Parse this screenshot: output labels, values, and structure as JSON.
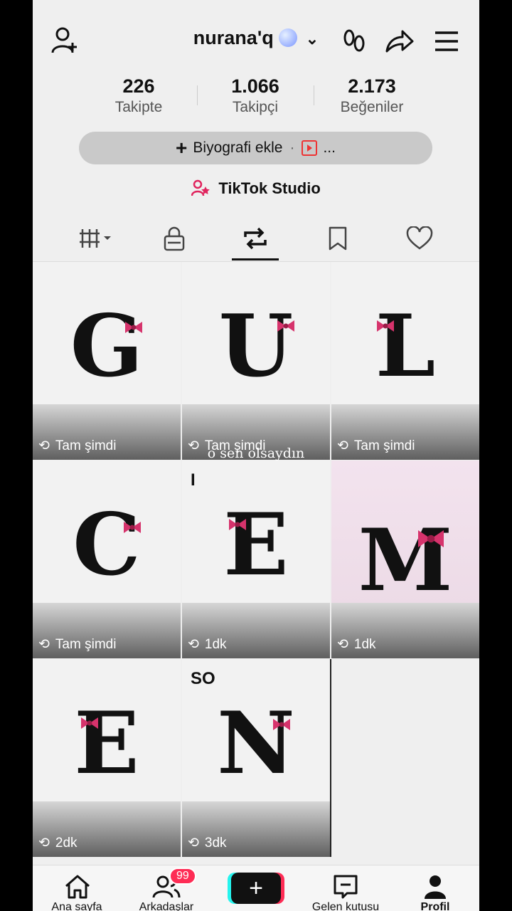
{
  "header": {
    "username": "nurana'q"
  },
  "stats": [
    {
      "value": "226",
      "label": "Takipte"
    },
    {
      "value": "1.066",
      "label": "Takipçi"
    },
    {
      "value": "2.173",
      "label": "Beğeniler"
    }
  ],
  "bio_button": {
    "label": "Biyografi ekle",
    "extra": "..."
  },
  "studio": {
    "label": "TikTok Studio"
  },
  "posts": [
    {
      "letter": "G",
      "time": "Tam şimdi"
    },
    {
      "letter": "U",
      "time": "Tam şimdi"
    },
    {
      "letter": "L",
      "time": "Tam şimdi"
    },
    {
      "letter": "C",
      "time": "Tam şimdi"
    },
    {
      "letter": "E",
      "time": "1dk",
      "overlay": "I"
    },
    {
      "letter": "M",
      "time": "1dk"
    },
    {
      "letter": "E",
      "time": "2dk"
    },
    {
      "letter": "N",
      "time": "3dk",
      "overlay": "SO"
    }
  ],
  "overlay_caption": "o sen olsaydın",
  "nav": {
    "home": "Ana sayfa",
    "friends": "Arkadaşlar",
    "friends_badge": "99",
    "create": "+",
    "inbox": "Gelen kutusu",
    "profile": "Profil"
  },
  "colors": {
    "accent": "#fe2c55",
    "teal": "#25f4ee",
    "bow": "#d6336c"
  }
}
